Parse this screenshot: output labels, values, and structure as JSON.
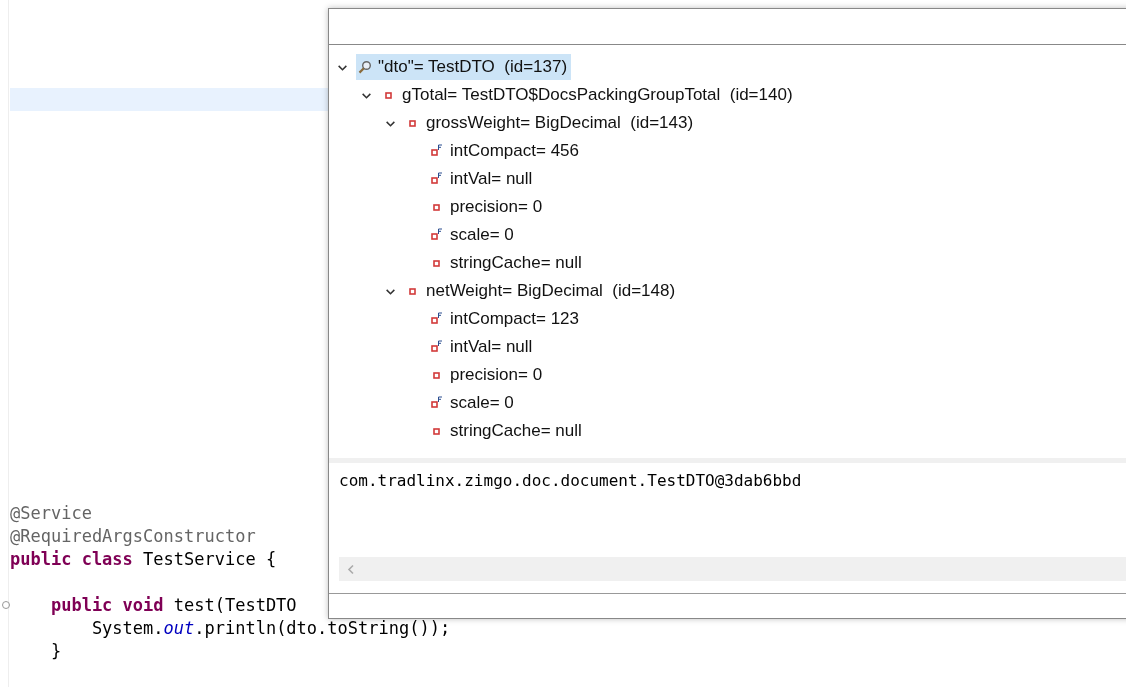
{
  "editor": {
    "blocks": [
      {
        "lines": [
          {
            "tokens": [
              {
                "kind": "annotation",
                "text": "@Service"
              }
            ]
          },
          {
            "tokens": [
              {
                "kind": "annotation",
                "text": "@RequiredArgsConstructor"
              }
            ]
          },
          {
            "tokens": [
              {
                "kind": "keyword",
                "text": "public class "
              },
              {
                "kind": "plain",
                "text": "TestService {"
              }
            ]
          }
        ]
      },
      {
        "lines": [
          {
            "fold": true,
            "tokens": [
              {
                "kind": "keyword",
                "text": "    public void "
              },
              {
                "kind": "plain",
                "text": "test(TestDTO "
              }
            ]
          },
          {
            "tokens": [
              {
                "kind": "plain",
                "text": "        System."
              },
              {
                "kind": "field",
                "text": "out"
              },
              {
                "kind": "plain",
                "text": ".println(dto.toString());"
              }
            ]
          },
          {
            "tokens": [
              {
                "kind": "plain",
                "text": "    }"
              }
            ]
          }
        ]
      }
    ]
  },
  "inspector": {
    "tree": [
      {
        "kind": "local",
        "label": "\"dto\"= TestDTO  (id=137)",
        "expanded": true,
        "selected": true,
        "children": [
          {
            "kind": "field",
            "label": "gTotal= TestDTO$DocsPackingGroupTotal  (id=140)",
            "expanded": true,
            "selected": false,
            "children": [
              {
                "kind": "field",
                "label": "grossWeight= BigDecimal  (id=143)",
                "expanded": true,
                "selected": false,
                "children": [
                  {
                    "kind": "final_field",
                    "label": "intCompact= 456",
                    "selected": false
                  },
                  {
                    "kind": "final_field",
                    "label": "intVal= null",
                    "selected": false
                  },
                  {
                    "kind": "field",
                    "label": "precision= 0",
                    "selected": false
                  },
                  {
                    "kind": "final_field",
                    "label": "scale= 0",
                    "selected": false
                  },
                  {
                    "kind": "field",
                    "label": "stringCache= null",
                    "selected": false
                  }
                ]
              },
              {
                "kind": "field",
                "label": "netWeight= BigDecimal  (id=148)",
                "expanded": true,
                "selected": false,
                "children": [
                  {
                    "kind": "final_field",
                    "label": "intCompact= 123",
                    "selected": false
                  },
                  {
                    "kind": "final_field",
                    "label": "intVal= null",
                    "selected": false
                  },
                  {
                    "kind": "field",
                    "label": "precision= 0",
                    "selected": false
                  },
                  {
                    "kind": "final_field",
                    "label": "scale= 0",
                    "selected": false
                  },
                  {
                    "kind": "field",
                    "label": "stringCache= null",
                    "selected": false
                  }
                ]
              }
            ]
          }
        ]
      }
    ],
    "detail": "com.tradlinx.zimgo.doc.document.TestDTO@3dab6bbd"
  }
}
